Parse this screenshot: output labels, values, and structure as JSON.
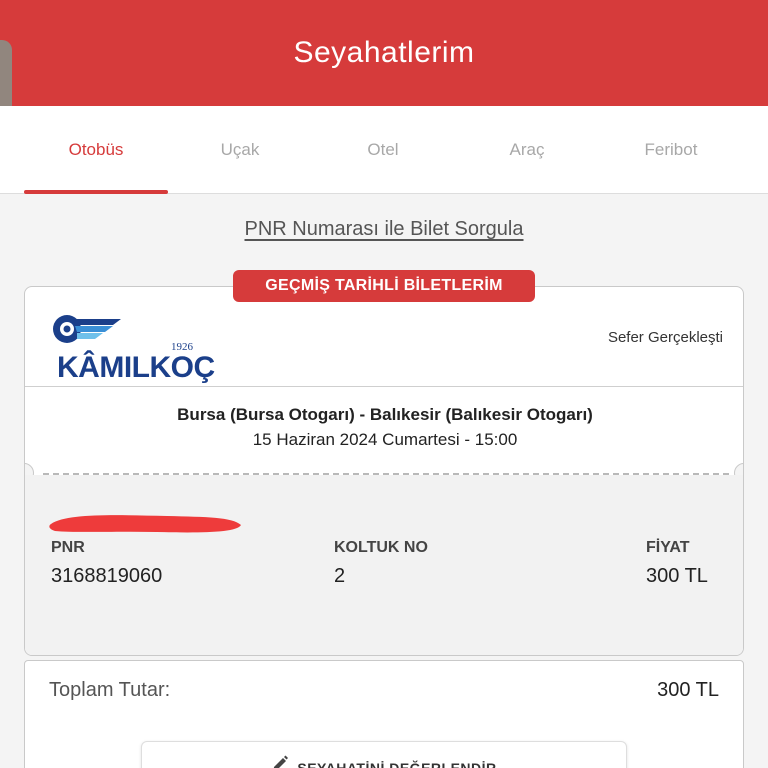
{
  "header": {
    "title": "Seyahatlerim"
  },
  "tabs": [
    {
      "label": "Otobüs",
      "active": true
    },
    {
      "label": "Uçak",
      "active": false
    },
    {
      "label": "Otel",
      "active": false
    },
    {
      "label": "Araç",
      "active": false
    },
    {
      "label": "Feribot",
      "active": false
    }
  ],
  "pnr_query": {
    "label": "PNR Numarası ile Bilet Sorgula"
  },
  "ticket": {
    "section_badge": "GEÇMİŞ TARİHLİ BİLETLERİM",
    "company": {
      "name": "KÂMILKOÇ",
      "year": "1926"
    },
    "status": "Sefer Gerçekleşti",
    "route": "Bursa (Bursa Otogarı) - Balıkesir (Balıkesir Otogarı)",
    "datetime": "15 Haziran 2024 Cumartesi - 15:00",
    "fields": {
      "pnr_label": "PNR",
      "pnr_value": "3168819060",
      "seat_label": "KOLTUK NO",
      "seat_value": "2",
      "price_label": "FİYAT",
      "price_value": "300 TL"
    }
  },
  "total": {
    "label": "Toplam Tutar:",
    "value": "300 TL"
  },
  "rate_button": {
    "label": "SEYAHATİNİ DEĞERLENDİR"
  },
  "colors": {
    "brand_red": "#d63b3b",
    "logo_blue": "#1b3f8a",
    "background": "#f4f4f4"
  }
}
